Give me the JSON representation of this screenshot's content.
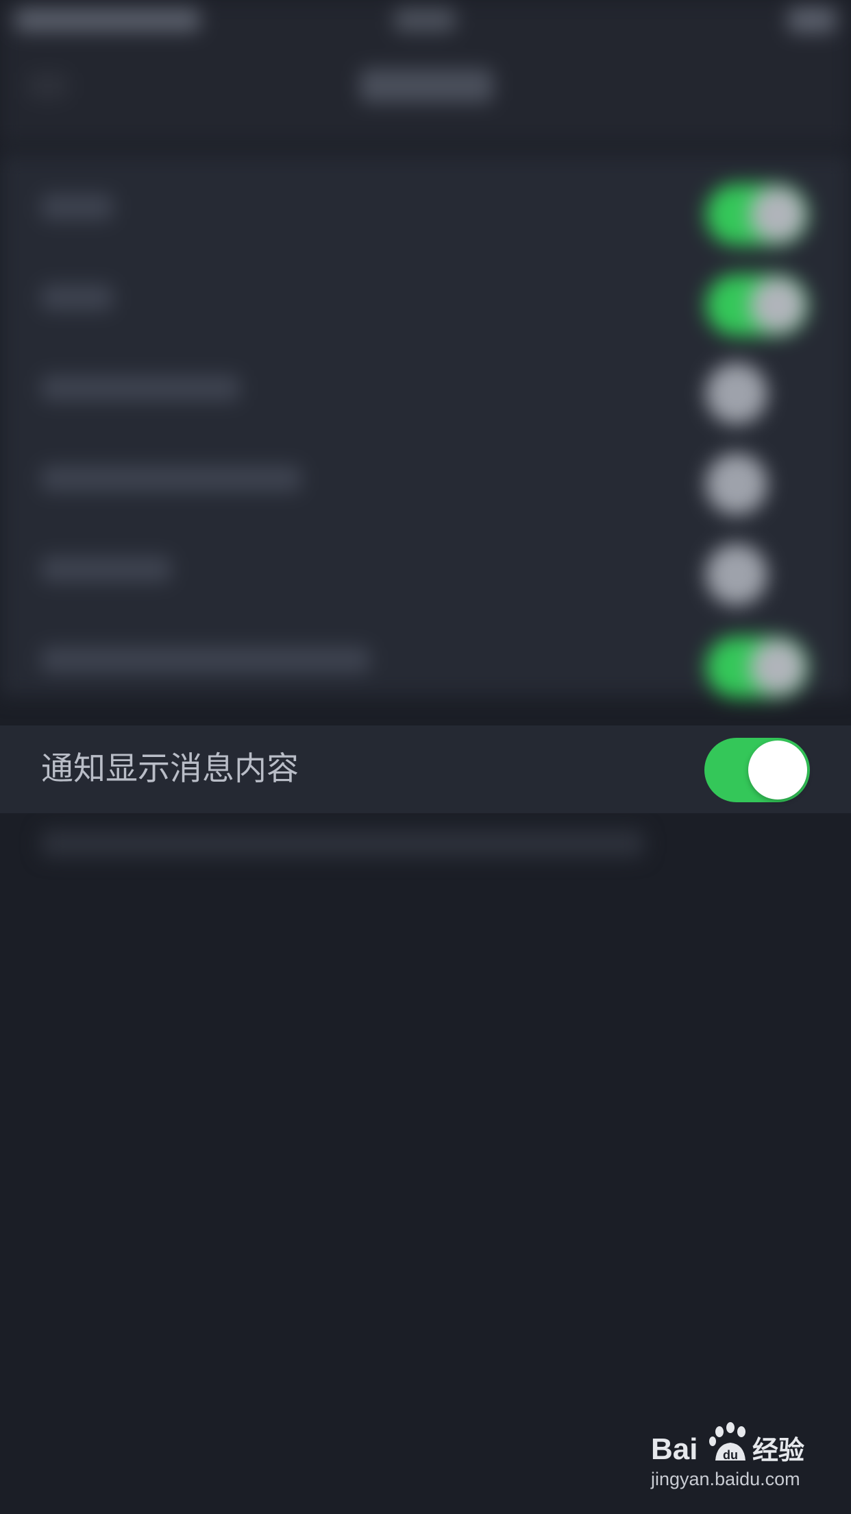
{
  "notification_setting": {
    "label": "通知显示消息内容",
    "enabled": true,
    "accent_color": "#34c759"
  },
  "background": {
    "blurred": true,
    "toggle_states": [
      true,
      true,
      false,
      false,
      false,
      true
    ]
  },
  "watermark": {
    "brand": "Bai du 经验",
    "url": "jingyan.baidu.com"
  }
}
